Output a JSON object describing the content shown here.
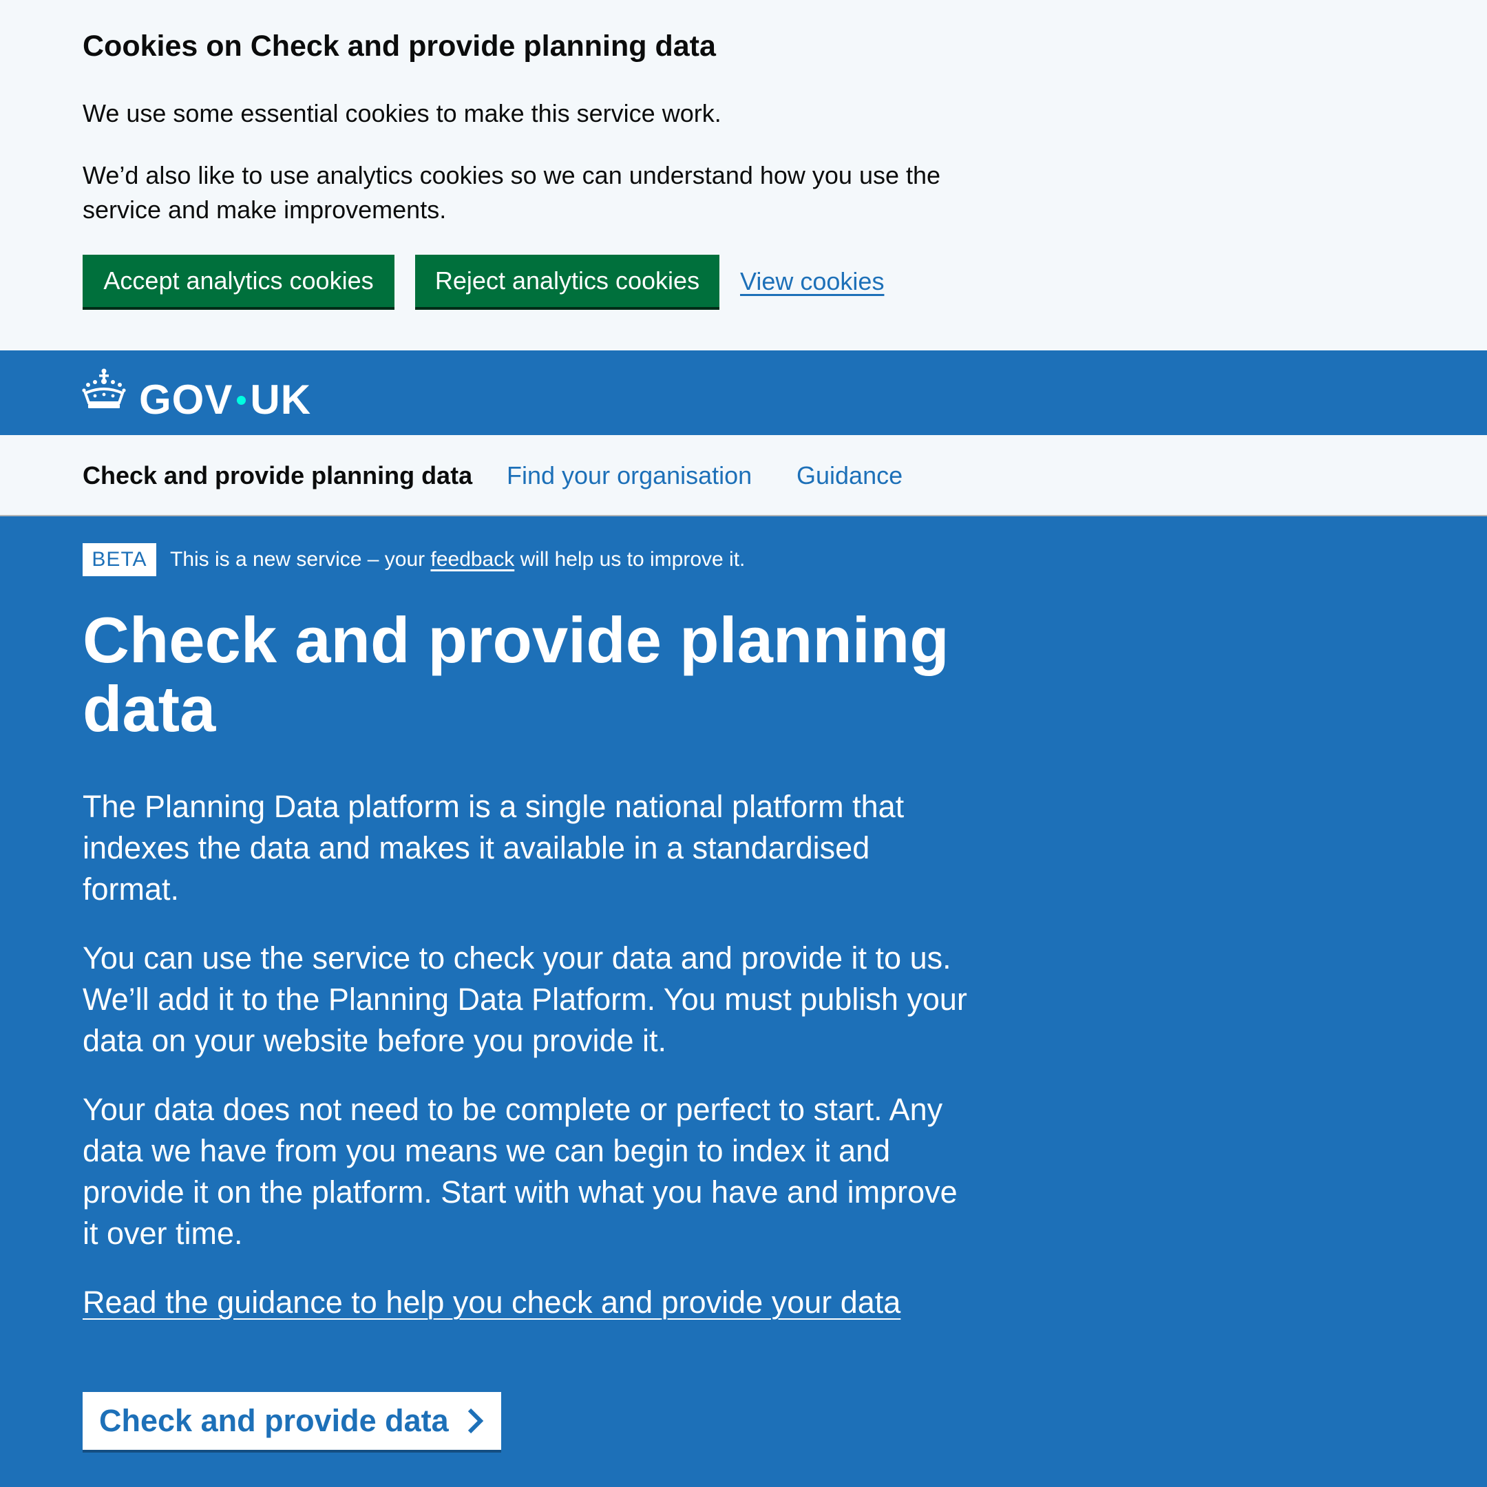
{
  "cookie_banner": {
    "title": "Cookies on Check and provide planning data",
    "paragraph_1": "We use some essential cookies to make this service work.",
    "paragraph_2": "We’d also like to use analytics cookies so we can understand how you use the service and make improvements.",
    "accept_label": "Accept analytics cookies",
    "reject_label": "Reject analytics cookies",
    "view_label": "View cookies"
  },
  "header": {
    "logo_icon": "crown-icon",
    "logotype_left": "GOV",
    "logotype_right": "UK"
  },
  "service_nav": {
    "service_name": "Check and provide planning data",
    "links": [
      "Find your organisation",
      "Guidance"
    ]
  },
  "phase_banner": {
    "tag": "BETA",
    "text_before": "This is a new service – your ",
    "link": "feedback",
    "text_after": " will help us to improve it."
  },
  "hero": {
    "title": "Check and provide planning data",
    "paragraphs": [
      "The Planning Data platform is a single national platform that indexes the data and makes it available in a standardised format.",
      "You can use the service to check your data and provide it to us. We’ll add it to the Planning Data Platform. You must publish your data on your website before you provide it.",
      "Your data does not need to be complete or perfect to start. Any data we have from you means we can begin to index it and provide it on the platform. Start with what you have and improve it over time."
    ],
    "guidance_link": "Read the guidance to help you check and provide your data",
    "start_button": "Check and provide data",
    "start_icon": "chevron-right-icon"
  },
  "colors": {
    "brand_blue": "#1d70b8",
    "button_green": "#00703c",
    "light_background": "#f4f8fb",
    "logo_dot": "#00ffe0"
  }
}
